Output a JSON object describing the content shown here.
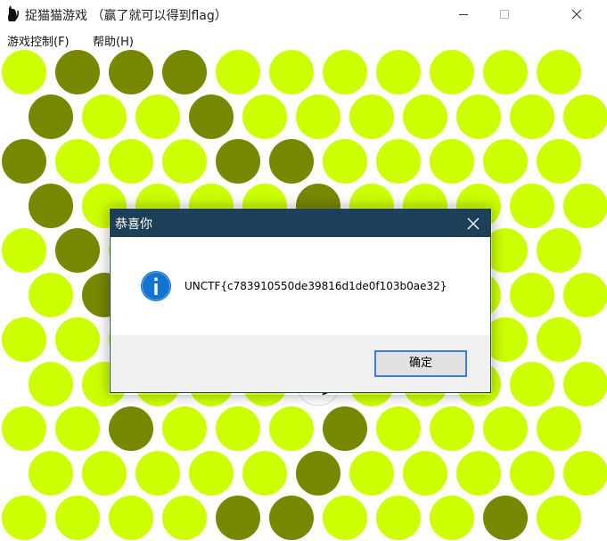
{
  "window": {
    "title": "捉猫猫游戏 （赢了就可以得到flag）",
    "icon": "cat-icon",
    "controls": [
      "minimize-icon",
      "maximize-icon",
      "close-icon"
    ]
  },
  "menu": {
    "items": [
      {
        "label": "游戏控制(F)"
      },
      {
        "label": "帮助(H)"
      }
    ]
  },
  "board": {
    "colors": {
      "empty": "#ccff00",
      "wall": "#778800",
      "background": "#ffffff"
    },
    "rows": [
      [
        1,
        2,
        2,
        2,
        1,
        1,
        1,
        1,
        1,
        1,
        1
      ],
      [
        2,
        1,
        1,
        2,
        1,
        1,
        1,
        1,
        1,
        1,
        1
      ],
      [
        2,
        1,
        1,
        1,
        2,
        2,
        1,
        1,
        1,
        1,
        1
      ],
      [
        2,
        1,
        1,
        1,
        1,
        2,
        1,
        1,
        1,
        1,
        1
      ],
      [
        1,
        2,
        1,
        1,
        1,
        1,
        1,
        1,
        1,
        1,
        1
      ],
      [
        1,
        2,
        1,
        1,
        1,
        1,
        1,
        1,
        1,
        1,
        1
      ],
      [
        1,
        1,
        1,
        1,
        1,
        1,
        1,
        1,
        1,
        1,
        1
      ],
      [
        1,
        1,
        1,
        1,
        1,
        0,
        1,
        1,
        1,
        1,
        1
      ],
      [
        1,
        1,
        2,
        1,
        1,
        1,
        2,
        1,
        1,
        1,
        1
      ],
      [
        1,
        1,
        1,
        1,
        1,
        2,
        1,
        1,
        1,
        1,
        1
      ],
      [
        1,
        1,
        1,
        1,
        2,
        2,
        1,
        1,
        1,
        2,
        1
      ]
    ]
  },
  "dialog": {
    "title": "恭喜你",
    "icon": "info-icon",
    "message": "UNCTF{c783910550de39816d1de0f103b0ae32}",
    "ok_label": "确定",
    "close_icon": "close-icon"
  }
}
